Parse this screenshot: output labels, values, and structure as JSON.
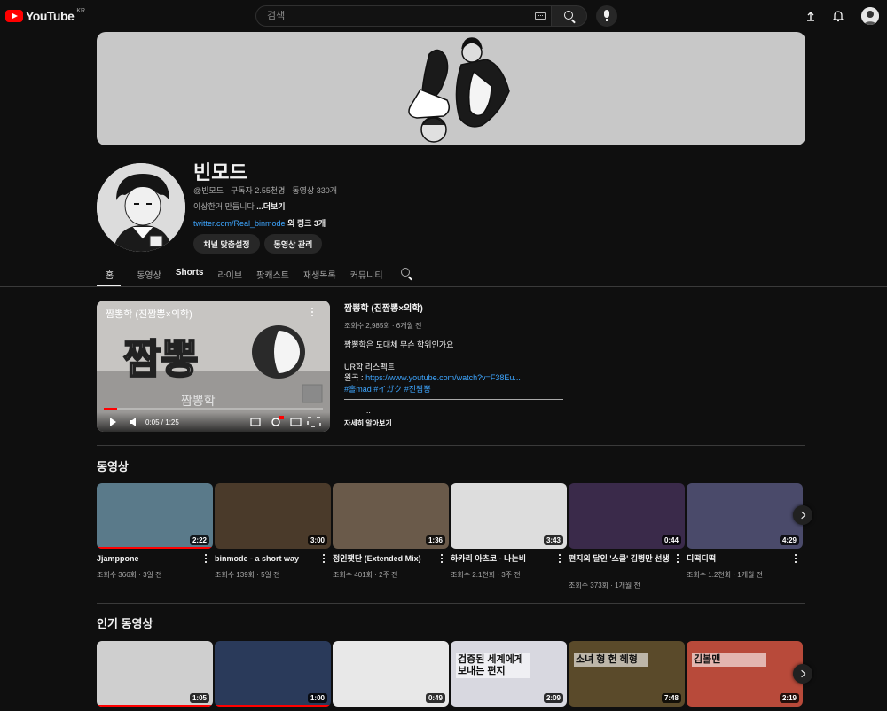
{
  "header": {
    "logo_text": "YouTube",
    "region": "KR",
    "search_placeholder": "검색"
  },
  "channel": {
    "name": "빈모드",
    "meta": "@빈모드 · 구독자 2.55천명 · 동영상 330개",
    "description": "이상한거 만듭니다 ",
    "more": "...더보기",
    "link": "twitter.com/Real_binmode",
    "link_suffix": " 외 링크 3개",
    "customize_button": "채널 맞춤설정",
    "manage_button": "동영상 관리"
  },
  "tabs": [
    "홈",
    "동영상",
    "Shorts",
    "라이브",
    "팟캐스트",
    "재생목록",
    "커뮤니티"
  ],
  "featured": {
    "overlay_title": "짬뽕학 (진짬뽕×의학)",
    "time": "0:05 / 1:25",
    "progress": 0.06,
    "title": "짬뽕학 (진짬뽕×의학)",
    "meta": "조회수 2,985회 · 6개월 전",
    "desc_line1": "짬뽕학은 도대체 무슨 학위인가요",
    "desc_line2": "UR학 리스펙트",
    "desc_source_label": "원곡 : ",
    "desc_source_link": "https://www.youtube.com/watch?v=F38Eu...",
    "desc_tags": "#홀mad #イガク #진짬뽕",
    "desc_end": "ㅡㅡㅡ..",
    "more_link": "자세히 알아보기"
  },
  "videos_section": {
    "title": "동영상",
    "items": [
      {
        "title": "Jjamppone",
        "meta": "조회수 366회 · 3일 전",
        "duration": "2:22",
        "bg": "#5a7a8a"
      },
      {
        "title": "binmode - a short way",
        "meta": "조회수 139회 · 5일 전",
        "duration": "3:00",
        "bg": "#4a3a2a"
      },
      {
        "title": "정인팻단 (Extended Mix)",
        "meta": "조회수 401회 · 2주 전",
        "duration": "1:36",
        "bg": "#6a5a4a"
      },
      {
        "title": "하카리 아츠코 - 나는비",
        "meta": "조회수 2.1천회 · 3주 전",
        "duration": "3:43",
        "bg": "#dddddd"
      },
      {
        "title": "편지의 달인 '스쿨' 김병만 선생",
        "meta": "조회수 373회 · 1개월 전",
        "duration": "0:44",
        "bg": "#3a2a4a"
      },
      {
        "title": "디떡디떡",
        "meta": "조회수 1.2천회 · 1개월 전",
        "duration": "4:29",
        "bg": "#4a4a6a"
      }
    ]
  },
  "popular_section": {
    "title": "인기 동영상",
    "items": [
      {
        "duration": "1:05",
        "bg": "#cfcfcf"
      },
      {
        "duration": "1:00",
        "bg": "#2a3a5a"
      },
      {
        "duration": "0:49",
        "bg": "#e8e8e8"
      },
      {
        "duration": "2:09",
        "bg": "#d8d8e0",
        "overlay": "검증된 세계에게 보내는 편지"
      },
      {
        "duration": "7:48",
        "bg": "#5a4a2a",
        "overlay": "소녀 형 헌 헤형"
      },
      {
        "duration": "2:19",
        "bg": "#b84a3a",
        "overlay": "김볼맨"
      }
    ]
  }
}
